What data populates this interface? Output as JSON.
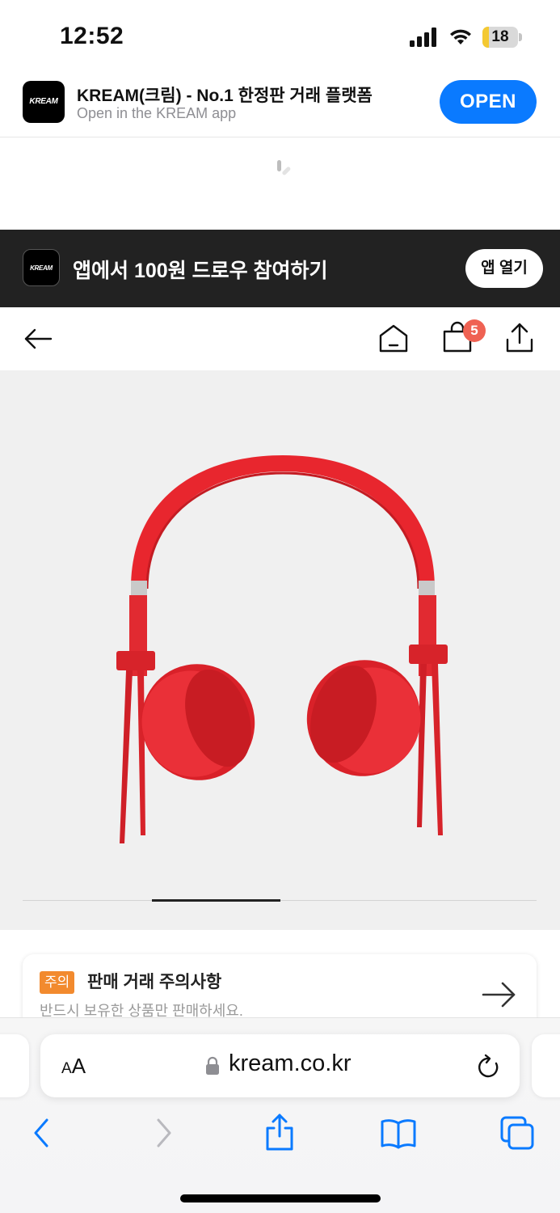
{
  "status_bar": {
    "time": "12:52",
    "battery_level": "18",
    "battery_fraction": 0.18,
    "icons": [
      "cellular-signal-icon",
      "wifi-icon",
      "battery-icon"
    ]
  },
  "smart_banner": {
    "app_name": "KREAM(크림) - No.1 한정판 거래 플랫폼",
    "subtitle": "Open in the KREAM app",
    "open_label": "OPEN",
    "logo_text": "KREAM"
  },
  "promo_banner": {
    "logo_text": "KREAM",
    "text": "앱에서 100원 드로우 참여하기",
    "button_label": "앱 열기"
  },
  "navbar": {
    "cart_count": "5",
    "icons": [
      "back-arrow-icon",
      "home-icon",
      "shopping-bag-icon",
      "share-icon"
    ]
  },
  "product_gallery": {
    "image": "red-headphones",
    "slide_count": 4,
    "active_slide": 2
  },
  "notice": {
    "tag": "주의",
    "title": "판매 거래 주의사항",
    "subtitle": "반드시 보유한 상품만 판매하세요."
  },
  "safari": {
    "text_size_label_small": "A",
    "text_size_label_large": "A",
    "url": "kream.co.kr",
    "toolbar": [
      "back-icon",
      "forward-icon",
      "share-icon",
      "bookmarks-icon",
      "tabs-icon"
    ]
  },
  "colors": {
    "open_button": "#0a7aff",
    "promo_background": "#222222",
    "badge": "#ef6253",
    "notice_tag": "#f28a2e",
    "product_background": "#f0f0f0",
    "safari_accent": "#0a7aff"
  }
}
